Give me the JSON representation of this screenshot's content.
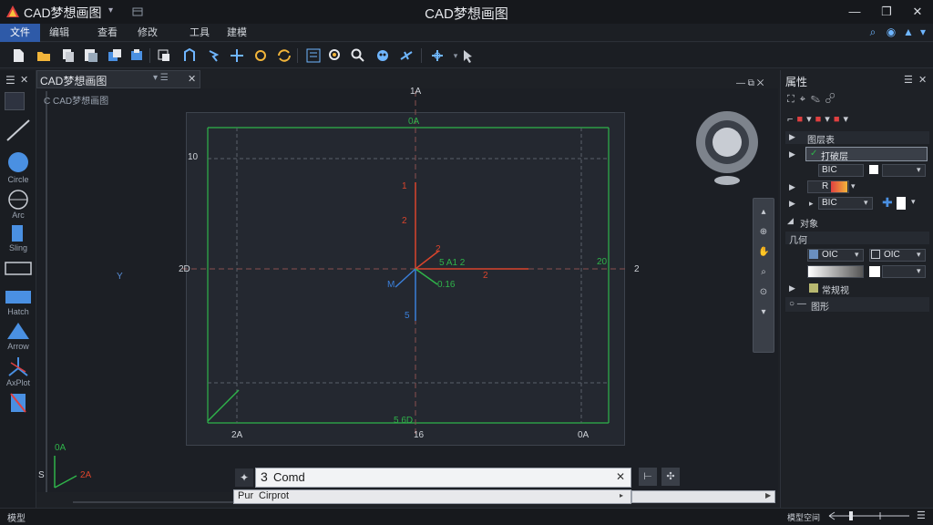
{
  "titlebar": {
    "app_name": "CAD梦想画图",
    "window_title": "CAD梦想画图",
    "minimize": "—",
    "maximize": "❐",
    "close": "✕"
  },
  "menubar": {
    "items": [
      "文件",
      "编辑",
      "查看",
      "修改",
      "工具",
      "建模"
    ]
  },
  "document": {
    "tab_label": "CAD梦想画图",
    "sub_label": "C CAD梦想画图"
  },
  "left_tools": [
    {
      "icon": "line-icon",
      "label": ""
    },
    {
      "icon": "circle-icon",
      "label": "Circle"
    },
    {
      "icon": "arc-icon",
      "label": "Arc"
    },
    {
      "icon": "rect-icon",
      "label": "Sling"
    },
    {
      "icon": "rectangle-icon",
      "label": ""
    },
    {
      "icon": "hatch-icon",
      "label": "Hatch"
    },
    {
      "icon": "triangle-icon",
      "label": "Arrow"
    },
    {
      "icon": "axis-icon",
      "label": "AxPlot"
    },
    {
      "icon": "erase-icon",
      "label": ""
    }
  ],
  "drawing": {
    "top_label": "1A",
    "left_label": "2D",
    "right_label": "2",
    "y_label": "10",
    "frame_top": "0A",
    "frame_bottom": "5 6D",
    "corner_bl": "2A",
    "corner_bm": "16",
    "corner_br": "0A",
    "label_1": "1",
    "label_2": "2",
    "label_3": "2",
    "label_4": "5 A1 2",
    "label_5": "2",
    "label_6": "M",
    "label_7": "0.16",
    "label_8": "5",
    "label_9": "20",
    "side_y": "Y",
    "ucs_x": "2A",
    "ucs_y": "0A",
    "ucs_s": "S"
  },
  "command": {
    "input_value": "Comd",
    "input_prefix": "3",
    "prompt_label": "Pur",
    "prompt_value": "Cirprot"
  },
  "properties": {
    "title": "属性",
    "section_general": "图层表",
    "layer_field": "打破层",
    "color_value": "BIC",
    "color2_value": "BIC",
    "r_label": "R",
    "section_misc": "对象",
    "section_geom": "几何",
    "geom_value_1": "OIC",
    "geom_value_2": "OIC",
    "section_view": "常规视",
    "section_other": "图形"
  },
  "status": {
    "left_text": "模型",
    "right_text": "模型空间"
  },
  "colors": {
    "green_frame": "#2fb34a",
    "red_axis": "#d9442c",
    "blue_axis": "#3a7fd9",
    "accent": "#2e5aa8"
  }
}
